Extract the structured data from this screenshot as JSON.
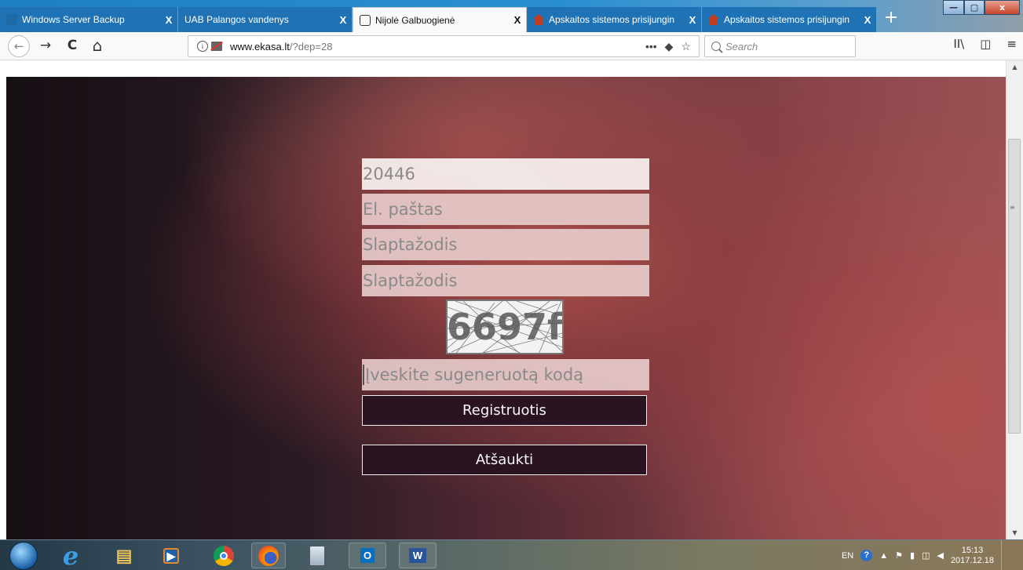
{
  "browser": {
    "tabs": [
      {
        "label": "Windows Server Backup",
        "close": "X"
      },
      {
        "label": "UAB Palangos vandenys",
        "close": "X"
      },
      {
        "label": "Nijolė Galbuogienė",
        "close": "X"
      },
      {
        "label": "Apskaitos sistemos prisijungin",
        "close": "X"
      },
      {
        "label": "Apskaitos sistemos prisijungin",
        "close": "X"
      }
    ],
    "new_tab": "+",
    "window_controls": {
      "minimize": "—",
      "maximize": "▢",
      "close": "x"
    },
    "nav": {
      "back": "←",
      "forward": "→",
      "reload": "C",
      "home": "⌂"
    },
    "url": {
      "host": "www.ekasa.lt",
      "path": "/?dep=28"
    },
    "url_actions": {
      "more": "•••",
      "pocket": "◆",
      "bookmark": "☆"
    },
    "search_placeholder": "Search",
    "toolbar_right": {
      "library": "II\\",
      "sidebar": "◫",
      "menu": "≡"
    }
  },
  "form": {
    "department_code": "20446",
    "email_placeholder": "El. paštas",
    "password_placeholder": "Slaptažodis",
    "password_confirm_placeholder": "Slaptažodis",
    "captcha_text": "6697f",
    "captcha_input_placeholder": "Įveskite sugeneruotą kodą",
    "register_label": "Registruotis",
    "cancel_label": "Atšaukti"
  },
  "taskbar": {
    "apps": [
      {
        "name": "ie",
        "glyph": "e"
      },
      {
        "name": "explorer",
        "glyph": "▤"
      },
      {
        "name": "media-player",
        "glyph": "▶"
      },
      {
        "name": "chrome",
        "glyph": "●"
      },
      {
        "name": "firefox",
        "glyph": "●"
      },
      {
        "name": "calculator",
        "glyph": "▦"
      },
      {
        "name": "outlook",
        "glyph": "O"
      },
      {
        "name": "word",
        "glyph": "W"
      }
    ],
    "tray": {
      "lang": "EN",
      "help": "?",
      "time": "15:13",
      "date": "2017.12.18"
    }
  }
}
